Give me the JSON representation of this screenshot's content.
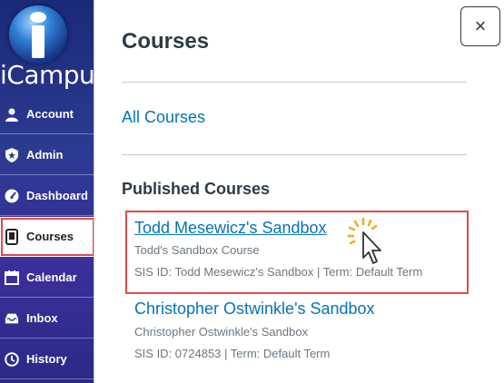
{
  "sidebar": {
    "logo_text": "iCampus",
    "items": [
      {
        "label": "Account",
        "icon": "user-icon"
      },
      {
        "label": "Admin",
        "icon": "shield-icon"
      },
      {
        "label": "Dashboard",
        "icon": "dashboard-icon"
      },
      {
        "label": "Courses",
        "icon": "book-icon"
      },
      {
        "label": "Calendar",
        "icon": "calendar-icon"
      },
      {
        "label": "Inbox",
        "icon": "inbox-icon"
      },
      {
        "label": "History",
        "icon": "clock-icon"
      }
    ],
    "active_item": "Courses"
  },
  "tray": {
    "title": "Courses",
    "close_label": "×",
    "all_courses_label": "All Courses",
    "published_heading": "Published Courses",
    "courses": [
      {
        "title": "Todd Mesewicz's Sandbox",
        "subtitle": "Todd's Sandbox Course",
        "meta": "SIS ID: Todd Mesewicz's Sandbox | Term: Default Term"
      },
      {
        "title": "Christopher Ostwinkle's Sandbox",
        "subtitle": "Christopher Ostwinkle's Sandbox",
        "meta": "SIS ID: 0724853 | Term: Default Term"
      }
    ]
  },
  "colors": {
    "link": "#0374b5",
    "text": "#2d3b45",
    "muted": "#6b7780",
    "highlight": "#e04a4a",
    "sidebar": "#2c3a92"
  }
}
